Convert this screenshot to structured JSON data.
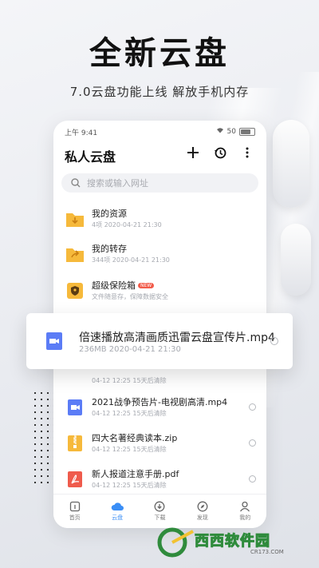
{
  "promo": {
    "title": "全新云盘",
    "subtitle": "7.0云盘功能上线  解放手机内存"
  },
  "status_bar": {
    "time": "上午 9:41",
    "battery": "50"
  },
  "header": {
    "title": "私人云盘",
    "icons": [
      "add-icon",
      "history-icon",
      "more-icon"
    ]
  },
  "search": {
    "placeholder": "搜索或输入网址"
  },
  "files": [
    {
      "name": "我的资源",
      "meta": "4项  2020-04-21  21:30",
      "icon": "folder-download-icon"
    },
    {
      "name": "我的转存",
      "meta": "344项  2020-04-21  21:30",
      "icon": "folder-share-icon"
    },
    {
      "name": "超级保险箱",
      "badge": "NEW",
      "meta": "文件随意存，保障数据安全",
      "icon": "safe-box-icon"
    },
    {
      "name": "",
      "meta": "04-12  12:25    15天后清除",
      "icon": ""
    },
    {
      "name": "2021战争预告片-电视剧高清.mp4",
      "meta": "04-12  12:25    15天后清除",
      "icon": "video-file-icon"
    },
    {
      "name": "四大名著经典读本.zip",
      "meta": "04-12  12:25    15天后清除",
      "icon": "zip-file-icon"
    },
    {
      "name": "新人报道注意手册.pdf",
      "meta": "04-12  12:25    15天后清除",
      "icon": "pdf-file-icon"
    }
  ],
  "highlighted_file": {
    "name": "倍速播放高清画质迅雷云盘宣传片.mp4",
    "meta": "236MB  2020-04-21  21:30",
    "icon": "video-file-icon"
  },
  "tabs": [
    {
      "label": "首页",
      "icon": "home-icon",
      "active": false
    },
    {
      "label": "云盘",
      "icon": "cloud-icon",
      "active": true
    },
    {
      "label": "下载",
      "icon": "download-icon",
      "active": false
    },
    {
      "label": "发现",
      "icon": "compass-icon",
      "active": false
    },
    {
      "label": "我的",
      "icon": "profile-icon",
      "active": false
    }
  ],
  "watermark": {
    "text": "西西软件园",
    "url": "CR173.COM"
  },
  "colors": {
    "accent": "#3a8ef6",
    "folder": "#f6b93b",
    "video": "#5b7cf6",
    "pdf": "#ef5b4c",
    "badge": "#f25b4a"
  }
}
